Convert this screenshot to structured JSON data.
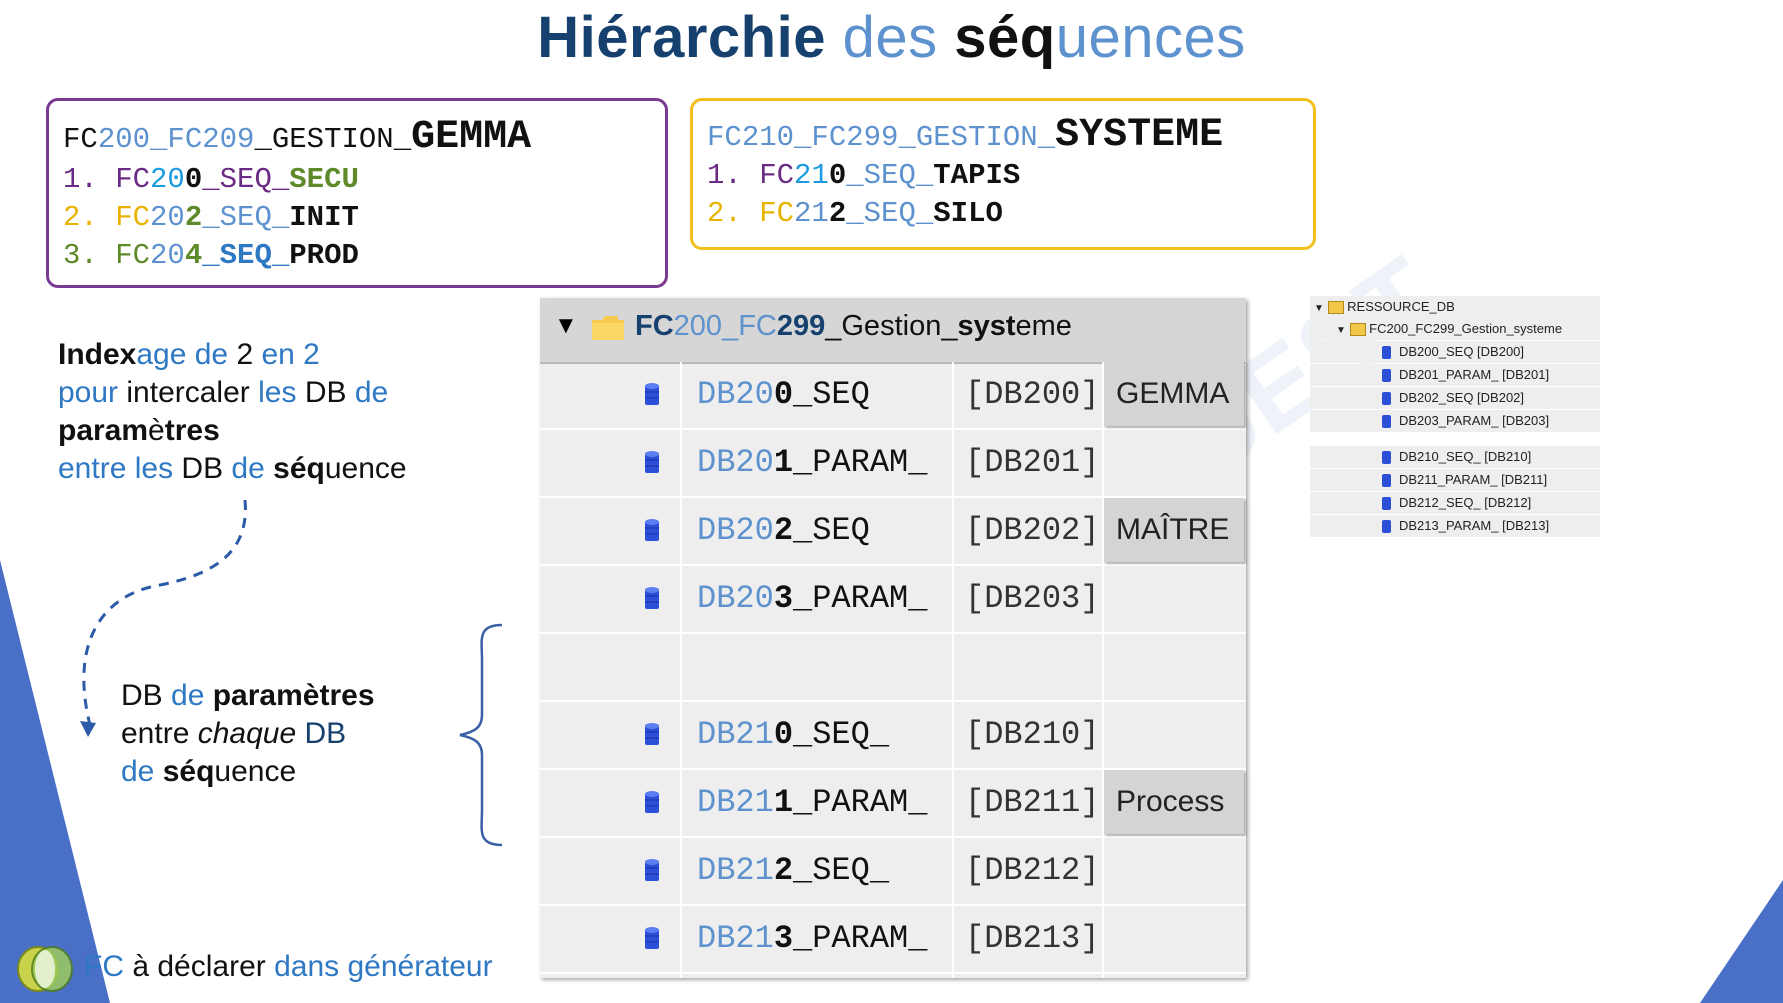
{
  "title": {
    "p1": "Hiérarchie",
    "p2": " des ",
    "p3": "séq",
    "p4": "uences"
  },
  "gemma_box": {
    "head": {
      "a": "FC",
      "b": "200",
      "c": "_FC",
      "d": "209",
      "e": "_GESTION_",
      "f": "GEMMA"
    },
    "items": [
      {
        "num": "1.",
        "fc": "FC",
        "d1": "20",
        "d2": "0",
        "u": "_SEQ_",
        "name": "SECU"
      },
      {
        "num": "2.",
        "fc": "FC",
        "d1": "20",
        "d2": "2",
        "u": "_SEQ_",
        "name": "INIT"
      },
      {
        "num": "3.",
        "fc": "FC",
        "d1": "20",
        "d2": "4",
        "u": "_SEQ_",
        "name": "PROD"
      }
    ]
  },
  "systeme_box": {
    "head": {
      "a": "FC",
      "b": "210",
      "c": "_FC",
      "d": "299",
      "e": "_GESTION_",
      "f": "SYSTEME"
    },
    "items": [
      {
        "num": "1.",
        "fc": "FC",
        "d1": "21",
        "d2": "0",
        "u": "_SEQ_",
        "name": "TAPIS"
      },
      {
        "num": "2.",
        "fc": "FC",
        "d1": "21",
        "d2": "2",
        "u": "_SEQ_",
        "name": "SILO"
      }
    ]
  },
  "left_note": {
    "l1a": "Index",
    "l1b": "age de ",
    "l1c": "2",
    "l1d": " en 2",
    "l2a": "pour ",
    "l2b": "intercaler",
    "l2c": " les ",
    "l2d": "DB",
    "l2e": " de",
    "l3a": "param",
    "l3b": "è",
    "l3c": "tres",
    "l4a": "entre les ",
    "l4b": "DB",
    "l4c": " de ",
    "l4d": "séq",
    "l4e": "uence"
  },
  "left_note2": {
    "l1a": "DB",
    "l1b": " de ",
    "l1c": "paramètres",
    "l2a": "entre ",
    "l2b": "chaque",
    "l2c": " DB",
    "l3a": "de ",
    "l3b": "séq",
    "l3c": "uence"
  },
  "bottom_note": {
    "a": "FC",
    "b": " à déclarer ",
    "c": "dans générateur"
  },
  "table": {
    "header": {
      "a": "FC",
      "b": "200",
      "c": "_FC",
      "d": "299",
      "e": "_Gestion_",
      "f": "syst",
      "g": "eme"
    },
    "rows": [
      {
        "pre": "DB",
        "d1": "20",
        "d2": "0",
        "suf": "_SEQ",
        "num": "[DB200]",
        "tag": "GEMMA"
      },
      {
        "pre": "DB",
        "d1": "20",
        "d2": "1",
        "suf": "_PARAM_",
        "num": "[DB201]",
        "tag": ""
      },
      {
        "pre": "DB",
        "d1": "20",
        "d2": "2",
        "suf": "_SEQ",
        "num": "[DB202]",
        "tag": "MAÎTRE"
      },
      {
        "pre": "DB",
        "d1": "20",
        "d2": "3",
        "suf": "_PARAM_",
        "num": "[DB203]",
        "tag": ""
      },
      {
        "pre": "",
        "d1": "",
        "d2": "",
        "suf": "",
        "num": "",
        "tag": ""
      },
      {
        "pre": "DB",
        "d1": "21",
        "d2": "0",
        "suf": "_SEQ_",
        "num": "[DB210]",
        "tag": ""
      },
      {
        "pre": "DB",
        "d1": "21",
        "d2": "1",
        "suf": "_PARAM_",
        "num": "[DB211]",
        "tag": "Process"
      },
      {
        "pre": "DB",
        "d1": "21",
        "d2": "2",
        "suf": "_SEQ_",
        "num": "[DB212]",
        "tag": ""
      },
      {
        "pre": "DB",
        "d1": "21",
        "d2": "3",
        "suf": "_PARAM_",
        "num": "[DB213]",
        "tag": ""
      }
    ]
  },
  "tree": {
    "root": "RESSOURCE_DB",
    "folder": "FC200_FC299_Gestion_systeme",
    "group1": [
      "DB200_SEQ [DB200]",
      "DB201_PARAM_ [DB201]",
      "DB202_SEQ [DB202]",
      "DB203_PARAM_ [DB203]"
    ],
    "group2": [
      "DB210_SEQ_ [DB210]",
      "DB211_PARAM_ [DB211]",
      "DB212_SEQ_ [DB212]",
      "DB213_PARAM_ [DB213]"
    ]
  },
  "colors": {
    "navy": "#16406e",
    "blue": "#2f78c4",
    "purple_border": "#7a3a92",
    "gold_border": "#f2bf1b",
    "db_icon": "#2b4fd6"
  },
  "watermark": "AEI OUEST"
}
